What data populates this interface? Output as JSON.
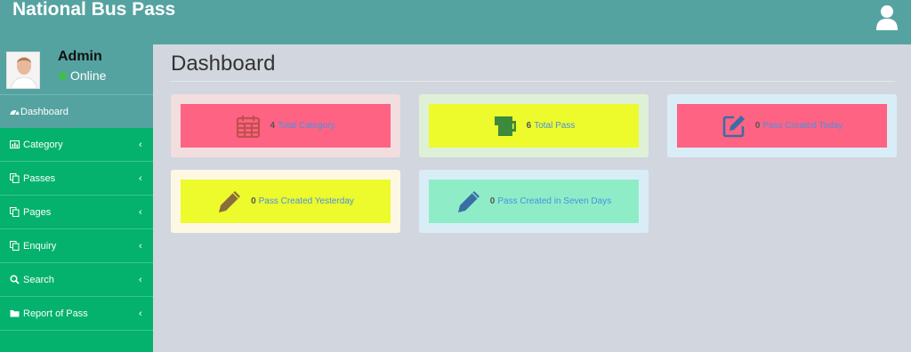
{
  "app": {
    "title": "National Bus Pass"
  },
  "header": {
    "user_icon": "user-icon"
  },
  "sidebar": {
    "user": {
      "name": "Admin",
      "status": "Online",
      "status_color": "#3fbf4a"
    },
    "dashboard_label": "Dashboard",
    "items": [
      {
        "label": "Category",
        "icon": "chart-icon"
      },
      {
        "label": "Passes",
        "icon": "copy-icon"
      },
      {
        "label": "Pages",
        "icon": "copy-icon"
      },
      {
        "label": "Enquiry",
        "icon": "copy-icon"
      },
      {
        "label": "Search",
        "icon": "search-icon"
      },
      {
        "label": "Report of Pass",
        "icon": "folder-icon"
      }
    ],
    "chevron": "‹"
  },
  "main": {
    "title": "Dashboard",
    "cards": [
      {
        "count": "4",
        "label": "Total Category",
        "icon": "calendar-icon",
        "outer": "#f2dede",
        "inner": "#ff6384",
        "icon_color": "#c0504d"
      },
      {
        "count": "6",
        "label": "Total Pass",
        "icon": "mug-icon",
        "outer": "#dff0d8",
        "inner": "#edfa2c",
        "icon_color": "#3c8a3c"
      },
      {
        "count": "0",
        "label": "Pass Created Today",
        "icon": "edit-icon",
        "outer": "#d9edf7",
        "inner": "#ff6384",
        "icon_color": "#3a6ea5"
      },
      {
        "count": "0",
        "label": "Pass Created Yesterday",
        "icon": "pencil-icon",
        "outer": "#fcf8e3",
        "inner": "#edfa2c",
        "icon_color": "#8a6d3b"
      },
      {
        "count": "0",
        "label": "Pass Created in Seven Days",
        "icon": "pencil-icon",
        "outer": "#d9edf7",
        "inner": "#8eedc7",
        "icon_color": "#3a6ea5"
      }
    ]
  }
}
